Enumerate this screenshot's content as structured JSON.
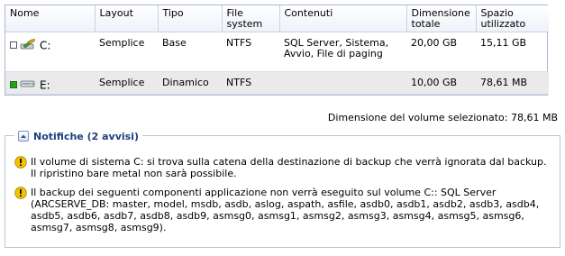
{
  "table": {
    "columns": {
      "name": "Nome",
      "layout": "Layout",
      "type": "Tipo",
      "filesystem": "File system",
      "contents": "Contenuti",
      "total_size": "Dimensione totale",
      "used_space": "Spazio utilizzato"
    },
    "rows": [
      {
        "name": "C:",
        "layout": "Semplice",
        "type": "Base",
        "filesystem": "NTFS",
        "contents": "SQL Server, Sistema, Avvio, File di paging",
        "total_size": "20,00 GB",
        "used_space": "15,11 GB",
        "checked": false,
        "icon": "system-drive-icon"
      },
      {
        "name": "E:",
        "layout": "Semplice",
        "type": "Dinamico",
        "filesystem": "NTFS",
        "contents": "",
        "total_size": "10,00 GB",
        "used_space": "78,61 MB",
        "checked": true,
        "icon": "drive-icon"
      }
    ]
  },
  "selected_volume_size": "Dimensione del volume selezionato: 78,61 MB",
  "notifications": {
    "title": "Notifiche (2 avvisi)",
    "items": [
      "Il volume di sistema C: si trova sulla catena della destinazione di backup che verrà ignorata dal backup. Il ripristino bare metal non sarà possibile.",
      "Il backup dei seguenti componenti applicazione non verrà eseguito sul volume C:: SQL Server (ARCSERVE_DB: master, model, msdb, asdb, aslog, aspath, asfile, asdb0, asdb1, asdb2, asdb3, asdb4, asdb5, asdb6, asdb7, asdb8, asdb9, asmsg0, asmsg1, asmsg2, asmsg3, asmsg4, asmsg5, asmsg6, asmsg7, asmsg8, asmsg9)."
    ],
    "icon": "warning-icon"
  },
  "colors": {
    "checked": "#1fa21f",
    "selected_row": "#eaeaea",
    "notif_title": "#1b3f80",
    "warning": "#f5c400"
  }
}
